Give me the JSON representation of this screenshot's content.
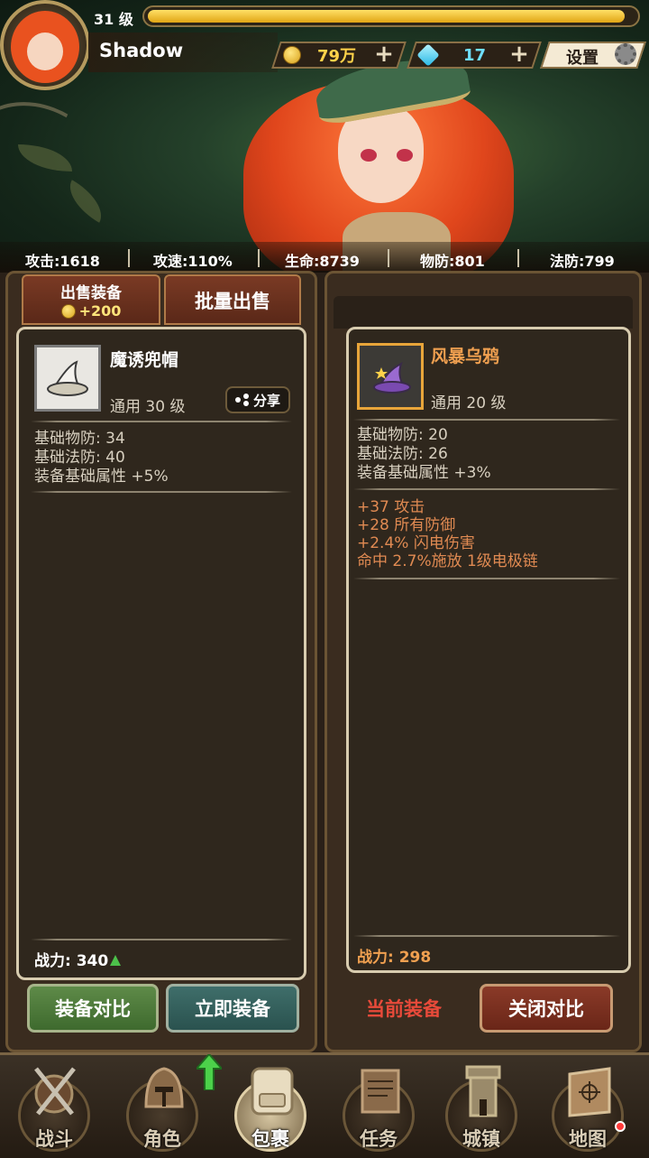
{
  "player": {
    "level": "31 级",
    "level_progress": 0.98,
    "name": "Shadow"
  },
  "currency": {
    "gold": "79万",
    "gems": "17",
    "plus": "+",
    "settings_label": "设置"
  },
  "stats": [
    "攻击:1618",
    "攻速:110%",
    "生命:8739",
    "物防:801",
    "法防:799"
  ],
  "left_panel": {
    "tab_sell_label": "出售装备",
    "tab_sell_price": "+200",
    "tab_batch_label": "批量出售",
    "item_name": "魔诱兜帽",
    "item_type_level": "通用  30 级",
    "share_label": "分享",
    "attrs": [
      "基础物防:  34",
      "基础法防:  40",
      "装备基础属性 +5%"
    ],
    "power_label": "战力:  340",
    "btn_compare": "装备对比",
    "btn_equip": "立即装备"
  },
  "right_panel": {
    "item_name": "风暴乌鸦",
    "item_type_level": "通用  20 级",
    "attrs": [
      "基础物防:  20",
      "基础法防:  26",
      "装备基础属性 +3%"
    ],
    "affixes": [
      "+37 攻击",
      "+28 所有防御",
      "+2.4% 闪电伤害",
      "命中 2.7%施放 1级电极链"
    ],
    "power_label": "战力:  298",
    "current_label": "当前装备",
    "btn_close": "关闭对比"
  },
  "nav": [
    {
      "label": "战斗",
      "icon": "sword-shield-icon"
    },
    {
      "label": "角色",
      "icon": "helmet-icon"
    },
    {
      "label": "包裹",
      "icon": "backpack-icon"
    },
    {
      "label": "任务",
      "icon": "scroll-icon"
    },
    {
      "label": "城镇",
      "icon": "tower-icon"
    },
    {
      "label": "地图",
      "icon": "map-icon"
    }
  ],
  "colors": {
    "accent_gold": "#e0a514",
    "affix_orange": "#e08a52",
    "current_red": "#e84a3a"
  }
}
